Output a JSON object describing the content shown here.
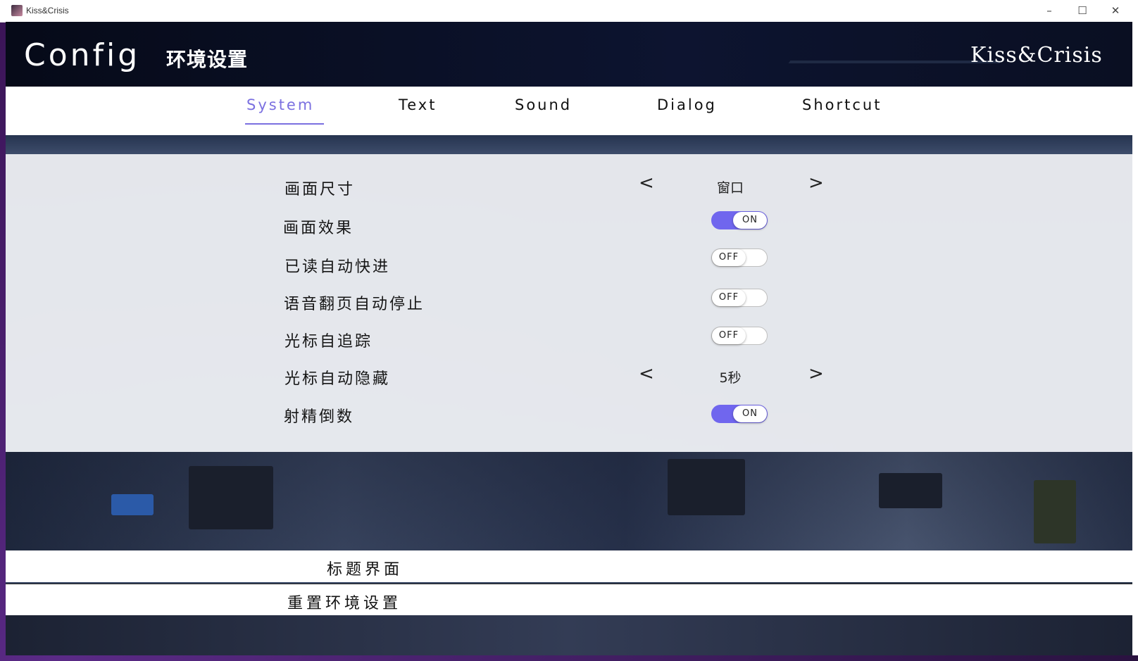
{
  "window": {
    "title": "Kiss&Crisis",
    "controls": {
      "minimize": "–",
      "maximize": "☐",
      "close": "✕"
    }
  },
  "header": {
    "title": "Config",
    "subtitle": "环境设置",
    "brand": "Kiss&Crisis"
  },
  "tabs": [
    {
      "label": "System",
      "active": true
    },
    {
      "label": "Text",
      "active": false
    },
    {
      "label": "Sound",
      "active": false
    },
    {
      "label": "Dialog",
      "active": false
    },
    {
      "label": "Shortcut",
      "active": false
    }
  ],
  "settings": {
    "screen_size": {
      "label": "画面尺寸",
      "value": "窗口",
      "prev": "<",
      "next": ">"
    },
    "screen_effect": {
      "label": "画面效果",
      "state": "ON"
    },
    "skip_read": {
      "label": "已读自动快进",
      "state": "OFF"
    },
    "voice_stop": {
      "label": "语音翻页自动停止",
      "state": "OFF"
    },
    "cursor_track": {
      "label": "光标自追踪",
      "state": "OFF"
    },
    "cursor_hide": {
      "label": "光标自动隐藏",
      "value": "5秒",
      "prev": "<",
      "next": ">"
    },
    "countdown": {
      "label": "射精倒数",
      "state": "ON"
    }
  },
  "buttons": {
    "title_screen": "标题界面",
    "reset_config": "重置环境设置"
  },
  "colors": {
    "accent": "#7066ee",
    "active_tab": "#7b70e0",
    "header_bg": "#0a0f22"
  }
}
